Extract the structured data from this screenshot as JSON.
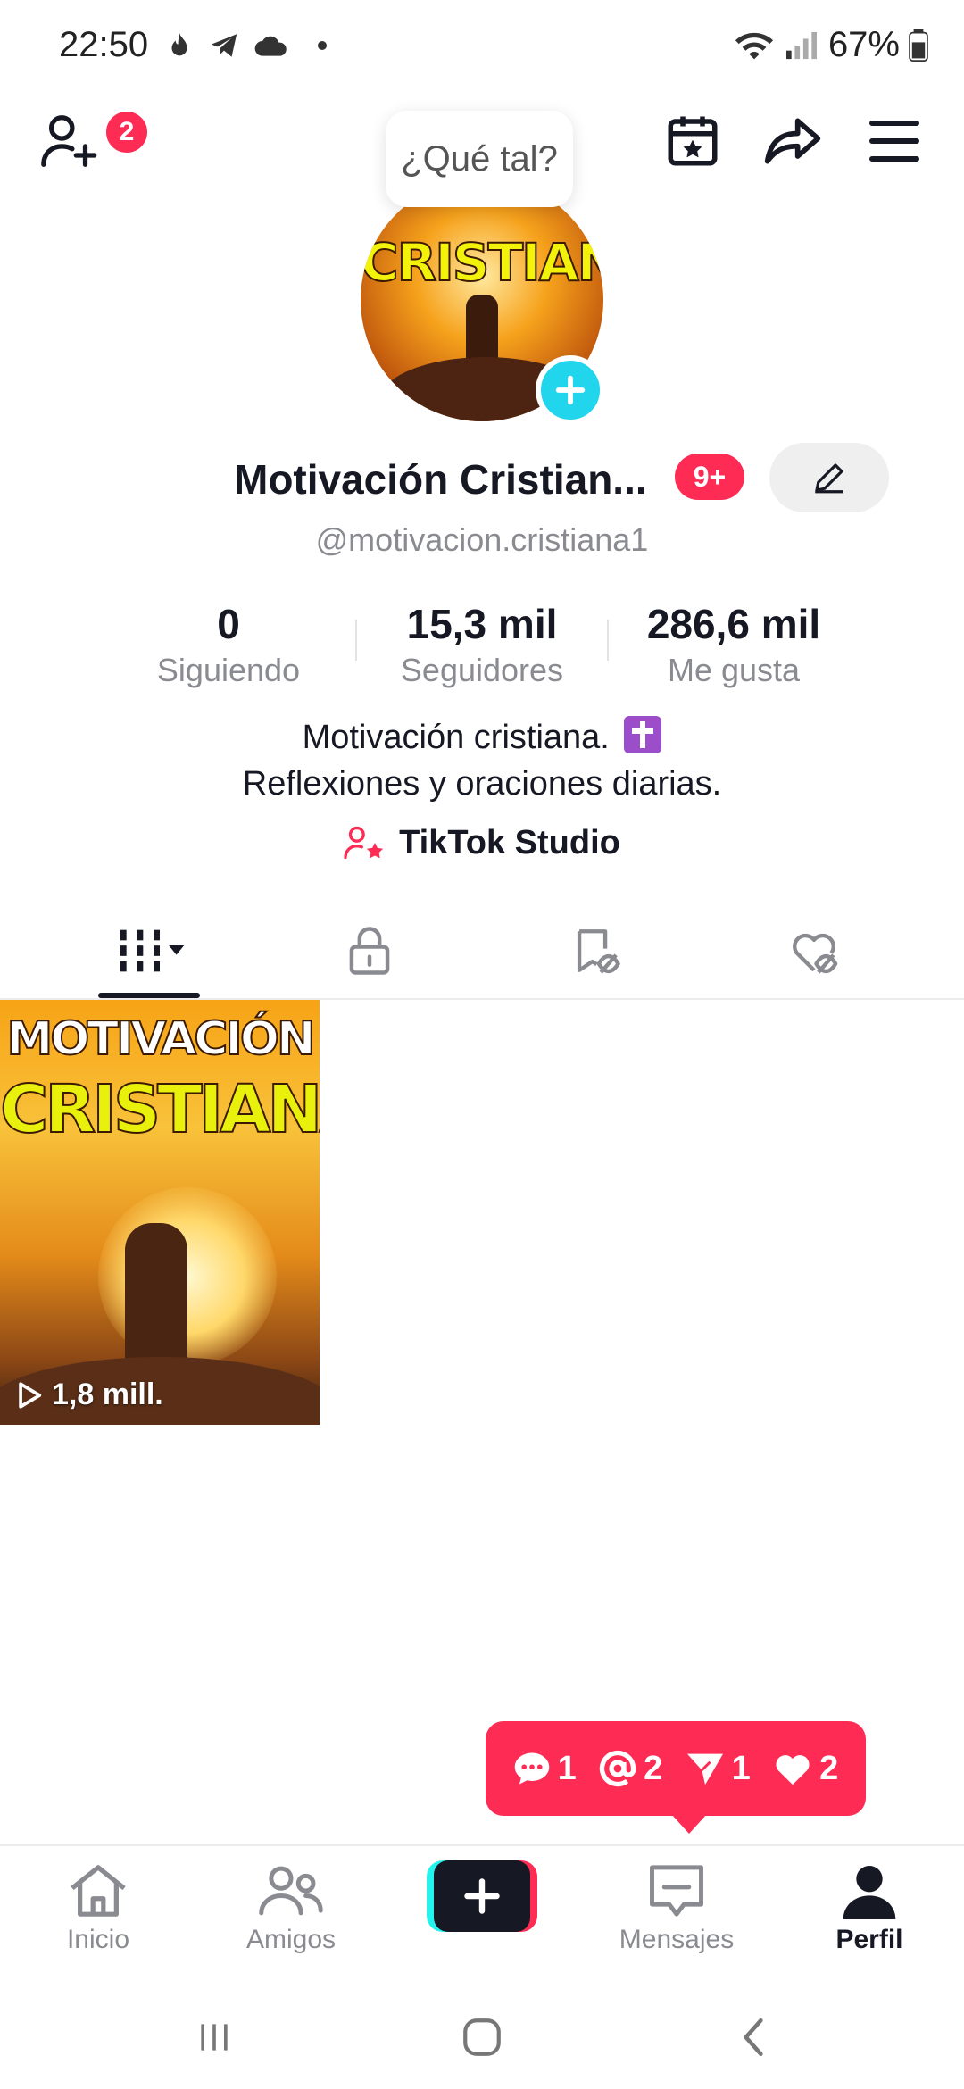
{
  "status_bar": {
    "time": "22:50",
    "battery": "67%",
    "icons": [
      "flame-icon",
      "telegram-icon",
      "cloud-icon",
      "dot-icon",
      "wifi-icon",
      "signal-icon",
      "battery-icon"
    ]
  },
  "header": {
    "friend_requests_badge": "2",
    "icons": [
      "add-friend-icon",
      "calendar-star-icon",
      "share-icon",
      "menu-icon"
    ]
  },
  "profile": {
    "mood_prompt": "¿Qué tal?",
    "avatar_text": "CRISTIANA",
    "display_name": "Motivación Cristian...",
    "name_badge": "9+",
    "handle": "@motivacion.cristiana1"
  },
  "stats": {
    "following_value": "0",
    "following_label": "Siguiendo",
    "followers_value": "15,3 mil",
    "followers_label": "Seguidores",
    "likes_value": "286,6 mil",
    "likes_label": "Me gusta"
  },
  "bio": {
    "line1": "Motivación cristiana.",
    "line2": "Reflexiones y oraciones diarias."
  },
  "studio": {
    "label": "TikTok Studio"
  },
  "tabs": [
    "videos-grid",
    "private",
    "saved-hidden",
    "liked-hidden"
  ],
  "videos": [
    {
      "title_top": "MOTIVACIÓN",
      "title_bottom": "CRISTIANA",
      "views": "1,8 mill."
    }
  ],
  "activity": {
    "comments": "1",
    "mentions": "2",
    "shares": "1",
    "likes": "2"
  },
  "bottom_nav": {
    "home": "Inicio",
    "friends": "Amigos",
    "inbox": "Mensajes",
    "profile": "Perfil"
  },
  "colors": {
    "accent": "#fe2c55",
    "cyan": "#25f4ee",
    "text": "#161823",
    "muted": "#8a8b91"
  }
}
